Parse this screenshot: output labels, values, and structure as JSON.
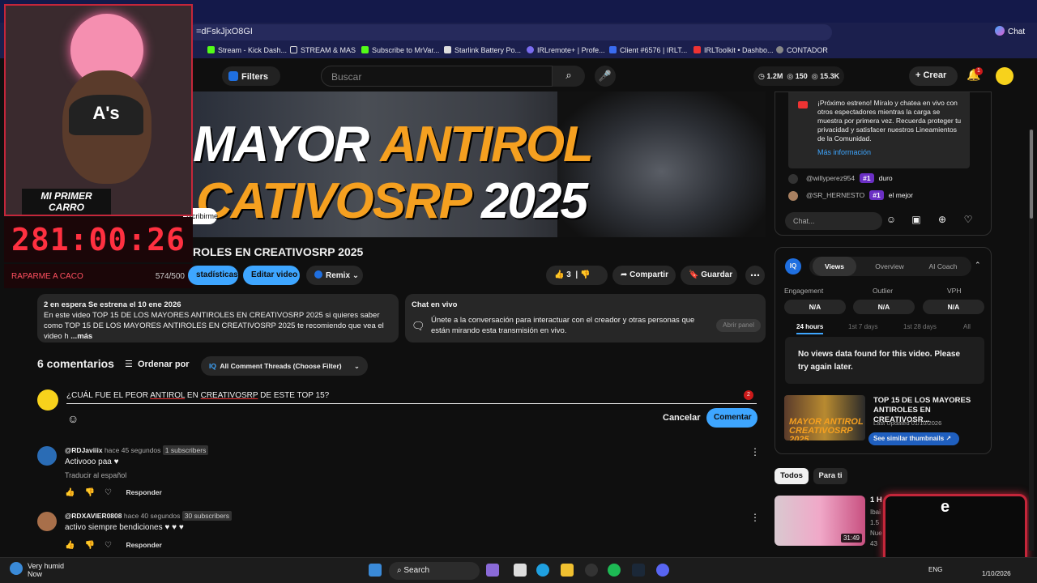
{
  "browser": {
    "url": "=dFskJjxO8GI",
    "chat_label": "Chat",
    "bookmarks": [
      {
        "label": "Stream - Kick Dash...",
        "color": "#53fc18"
      },
      {
        "label": "STREAM & MAS",
        "color": "#e8e8e8"
      },
      {
        "label": "Subscribe to MrVar...",
        "color": "#53fc18"
      },
      {
        "label": "Starlink Battery Po...",
        "color": "#e8e8e8"
      },
      {
        "label": "IRLremote+ | Profe...",
        "color": "#7a6cf0"
      },
      {
        "label": "Client #6576 | IRLT...",
        "color": "#3a6cf0"
      },
      {
        "label": "IRLToolkit • Dashbo...",
        "color": "#e33"
      },
      {
        "label": "CONTADOR",
        "color": "#888"
      }
    ]
  },
  "header": {
    "filters": "Filters",
    "search_placeholder": "Buscar",
    "stats": {
      "views": "1.2M",
      "likes": "150",
      "subs": "15.3K"
    },
    "create": "Crear",
    "notif_count": "1"
  },
  "overlay": {
    "badge_line1": "MI PRIMER",
    "badge_line2": "CARRO",
    "timer": "281:00:26",
    "goal_label": "RAPARME A CACO",
    "goal_count": "574/500",
    "hat_logo": "A's",
    "box_letter": "e",
    "subscribe_pill": "Iscribirme"
  },
  "video": {
    "thumb_line1_white": "MAYOR ",
    "thumb_line1_orange": "ANTIROL",
    "thumb_line2_orange": "CATIVOSRP ",
    "thumb_line2_white": "2025",
    "title": "ROLES EN CREATIVOSRP 2025",
    "btn_stats": "stadísticas",
    "btn_edit": "Editar video",
    "btn_remix": "Remix",
    "likes": "3",
    "share": "Compartir",
    "save": "Guardar"
  },
  "description": {
    "meta": "2 en espera  Se estrena el 10 ene 2026",
    "text": "En este video TOP 15 DE LOS MAYORES ANTIROLES EN CREATIVOSRP 2025 si quieres saber como TOP 15 DE LOS MAYORES ANTIROLES EN CREATIVOSRP 2025 te recomiendo que vea el video h",
    "more": "...más"
  },
  "chat_live": {
    "title": "Chat en vivo",
    "text": "Únete a la conversación para interactuar con el creador y otras personas que están mirando esta transmisión en vivo.",
    "button": "Abrir panel"
  },
  "comments": {
    "count": "6 comentarios",
    "sort": "Ordenar por",
    "filter": "All Comment Threads (Choose Filter)",
    "draft_prefix": "¿CUÁL FUE EL PEOR ",
    "draft_u1": "ANTIROL",
    "draft_mid": " EN ",
    "draft_u2": "CREATIVOSRP",
    "draft_suffix": " DE ESTE TOP 15?",
    "draft_badge": "2",
    "cancel": "Cancelar",
    "submit": "Comentar",
    "items": [
      {
        "user": "@RDJaviiix",
        "time": "hace 45 segundos",
        "subs": "1 subscribers",
        "text": "Activooo paa ♥",
        "translate": "Traducir al español",
        "reply": "Responder",
        "color": "#2a6cb5"
      },
      {
        "user": "@RDXAVIER0808",
        "time": "hace 40 segundos",
        "subs": "30 subscribers",
        "text": "activo siempre bendiciones ♥ ♥ ♥",
        "reply": "Responder",
        "color": "#a86f4a"
      }
    ]
  },
  "live_chat": {
    "notice": "¡Próximo estreno! Míralo y chatea en vivo con otros espectadores mientras la carga se muestra por primera vez. Recuerda proteger tu privacidad y satisfacer nuestros Lineamientos de la Comunidad.",
    "more": "Más información",
    "messages": [
      {
        "user": "@willyperez954",
        "badge": "#1",
        "text": "duro"
      },
      {
        "user": "@SR_HERNESTO",
        "badge": "#1",
        "text": "el mejor"
      }
    ],
    "input_placeholder": "Chat..."
  },
  "iq": {
    "logo": "IQ",
    "tabs": [
      "Views",
      "Overview",
      "AI Coach"
    ],
    "metrics": [
      {
        "label": "Engagement",
        "value": "N/A"
      },
      {
        "label": "Outlier",
        "value": "N/A"
      },
      {
        "label": "VPH",
        "value": "N/A"
      }
    ],
    "ranges": [
      "24 hours",
      "1st 7 days",
      "1st 28 days",
      "All"
    ],
    "no_views": "No views data found for this video. Please try again later.",
    "thumb_text": "MAYOR ANTIROL CREATIVOSRP 2025",
    "video_title": "TOP 15 DE LOS MAYORES ANTIROLES EN CREATIVOSR...",
    "last_updated": "Last Updated 01/10/2026",
    "similar": "See similar thumbnails ↗"
  },
  "chips": [
    "Todos",
    "Para ti"
  ],
  "recommended": {
    "title": "1 H",
    "duration": "31:49",
    "sub1": "Ibai",
    "sub2": "1.5",
    "sub3": "Nue",
    "sub4": "43"
  },
  "taskbar": {
    "weather_line1": "Very humid",
    "weather_line2": "Now",
    "search": "Search",
    "lang": "ENG",
    "date": "1/10/2026"
  }
}
